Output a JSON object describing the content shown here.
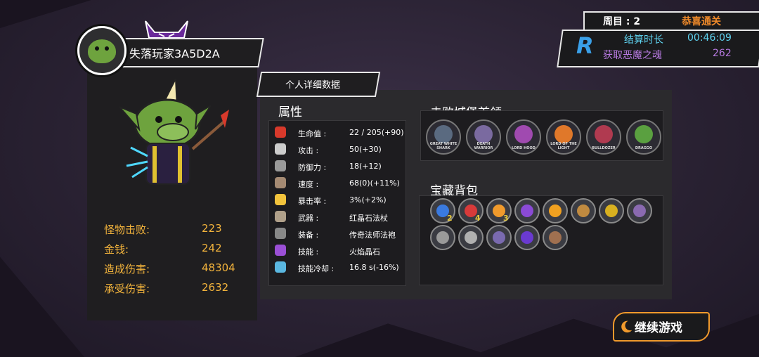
{
  "player": {
    "name": "失落玩家3A5D2A",
    "stats": [
      {
        "label": "怪物击败:",
        "value": "223"
      },
      {
        "label": "金钱:",
        "value": "242"
      },
      {
        "label": "造成伤害:",
        "value": "48304"
      },
      {
        "label": "承受伤害:",
        "value": "2632"
      }
    ]
  },
  "tab": {
    "label": "个人详细数据"
  },
  "attributes": {
    "title": "属性",
    "items": [
      {
        "label": "生命值 :",
        "value": "22 / 205(+90)",
        "icon": "heart-icon",
        "color": "#d8392b"
      },
      {
        "label": "攻击 :",
        "value": "50(+30)",
        "icon": "sword-icon",
        "color": "#cccccc"
      },
      {
        "label": "防御力 :",
        "value": "18(+12)",
        "icon": "shield-icon",
        "color": "#9a9a9a"
      },
      {
        "label": "速度 :",
        "value": "68(0)(+11%)",
        "icon": "boot-icon",
        "color": "#a58a73"
      },
      {
        "label": "暴击率 :",
        "value": "3%(+2%)",
        "icon": "crit-icon",
        "color": "#f2c33c"
      },
      {
        "label": "武器 :",
        "value": "红晶石法杖",
        "icon": "staff-icon",
        "color": "#b0a08a"
      },
      {
        "label": "装备 :",
        "value": "传奇法师法袍",
        "icon": "robe-icon",
        "color": "#888888"
      },
      {
        "label": "技能 :",
        "value": "火焰晶石",
        "icon": "crystal-icon",
        "color": "#9b4fd6"
      },
      {
        "label": "技能冷却 :",
        "value": "16.8 s(-16%)",
        "icon": "cooldown-icon",
        "color": "#5ab7e0"
      }
    ]
  },
  "bosses": {
    "title": "击败城堡首领",
    "items": [
      {
        "caption": "GREAT WHITE SHARK",
        "color": "#5a6a80"
      },
      {
        "caption": "DEATH WARRIOR",
        "color": "#7a6aa0"
      },
      {
        "caption": "LORD HOOD",
        "color": "#a04ab0"
      },
      {
        "caption": "LORD OF THE LIGHT",
        "color": "#e0782a"
      },
      {
        "caption": "BULLDOZER",
        "color": "#b03a50"
      },
      {
        "caption": "DRAGGO",
        "color": "#5aa040"
      }
    ]
  },
  "treasure": {
    "title": "宝藏背包",
    "items": [
      {
        "color": "#3a7ae0",
        "count": "2"
      },
      {
        "color": "#d83a3a",
        "count": "4"
      },
      {
        "color": "#f09a2c",
        "count": "3"
      },
      {
        "color": "#8a4ad6",
        "count": ""
      },
      {
        "color": "#f0a020",
        "count": ""
      },
      {
        "color": "#c08a40",
        "count": ""
      },
      {
        "color": "#d8b020",
        "count": ""
      },
      {
        "color": "#8a6ab0",
        "count": ""
      },
      {
        "color": "#9a9a9a",
        "count": ""
      },
      {
        "color": "#b0b0b0",
        "count": ""
      },
      {
        "color": "#7a6ab0",
        "count": ""
      },
      {
        "color": "#6a3ad0",
        "count": ""
      },
      {
        "color": "#a07050",
        "count": ""
      }
    ]
  },
  "hud": {
    "round_label": "周目 : 2",
    "congrats": "恭喜通关",
    "time_label": "结算时长",
    "time_value": "00:46:09",
    "souls_label": "获取恶魔之魂",
    "souls_value": "262",
    "logo_letter": "R"
  },
  "continue_button": {
    "label": "继续游戏"
  }
}
